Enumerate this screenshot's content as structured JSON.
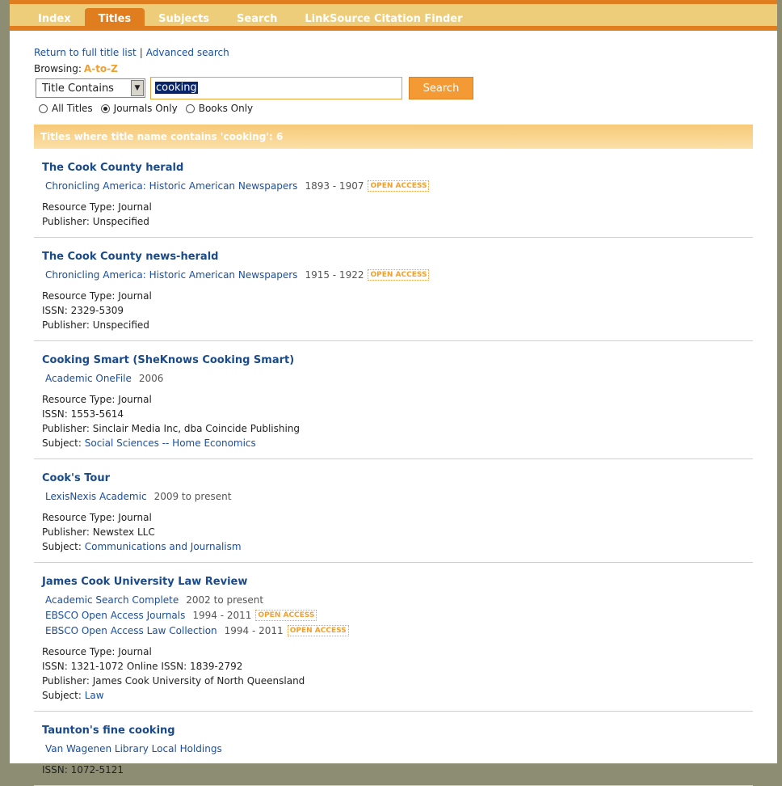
{
  "tabs": [
    "Index",
    "Titles",
    "Subjects",
    "Search",
    "LinkSource Citation Finder"
  ],
  "active_tab": 1,
  "links": {
    "return": "Return to full title list",
    "sep": "|",
    "advanced": "Advanced search"
  },
  "browsing": {
    "label": "Browsing:",
    "value": "A-to-Z"
  },
  "search": {
    "select_value": "Title Contains",
    "input_value": "cooking",
    "button": "Search",
    "radios": [
      {
        "label": "All Titles",
        "checked": false
      },
      {
        "label": "Journals Only",
        "checked": true
      },
      {
        "label": "Books Only",
        "checked": false
      }
    ]
  },
  "results_header": "Titles where title name contains 'cooking': 6",
  "results": [
    {
      "title": "The Cook County herald",
      "sources": [
        {
          "name": "Chronicling America: Historic American Newspapers",
          "dates": "1893 - 1907",
          "oa": "OPEN ACCESS"
        }
      ],
      "meta": [
        {
          "label": "Resource Type:",
          "value": "Journal"
        },
        {
          "label": "Publisher:",
          "value": "Unspecified"
        }
      ]
    },
    {
      "title": "The Cook County news-herald",
      "sources": [
        {
          "name": "Chronicling America: Historic American Newspapers",
          "dates": "1915 - 1922",
          "oa": "OPEN ACCESS"
        }
      ],
      "meta": [
        {
          "label": "Resource Type:",
          "value": "Journal"
        },
        {
          "label": "ISSN:",
          "value": "2329-5309"
        },
        {
          "label": "Publisher:",
          "value": "Unspecified"
        }
      ]
    },
    {
      "title": "Cooking Smart (SheKnows Cooking Smart)",
      "sources": [
        {
          "name": "Academic OneFile",
          "dates": "2006",
          "oa": ""
        }
      ],
      "meta": [
        {
          "label": "Resource Type:",
          "value": "Journal"
        },
        {
          "label": "ISSN:",
          "value": "1553-5614"
        },
        {
          "label": "Publisher:",
          "value": "Sinclair Media Inc, dba Coincide Publishing"
        },
        {
          "label": "Subject:",
          "value": "Social Sciences -- Home Economics",
          "link": true
        }
      ]
    },
    {
      "title": "Cook's Tour",
      "sources": [
        {
          "name": "LexisNexis Academic",
          "dates": "2009 to present",
          "oa": ""
        }
      ],
      "meta": [
        {
          "label": "Resource Type:",
          "value": "Journal"
        },
        {
          "label": "Publisher:",
          "value": "Newstex LLC"
        },
        {
          "label": "Subject:",
          "value": "Communications and Journalism",
          "link": true
        }
      ]
    },
    {
      "title": "James Cook University Law Review",
      "sources": [
        {
          "name": "Academic Search Complete",
          "dates": "2002 to present",
          "oa": ""
        },
        {
          "name": "EBSCO Open Access Journals",
          "dates": "1994 - 2011",
          "oa": "OPEN ACCESS"
        },
        {
          "name": "EBSCO Open Access Law Collection",
          "dates": "1994 - 2011",
          "oa": "OPEN ACCESS"
        }
      ],
      "meta": [
        {
          "label": "Resource Type:",
          "value": "Journal"
        },
        {
          "label": "ISSN:",
          "value": "1321-1072 Online ISSN: 1839-2792"
        },
        {
          "label": "Publisher:",
          "value": "James Cook University of North Queensland"
        },
        {
          "label": "Subject:",
          "value": "Law",
          "link": true
        }
      ]
    },
    {
      "title": "Taunton's fine cooking",
      "sources": [
        {
          "name": "Van Wagenen Library Local Holdings",
          "dates": "",
          "oa": ""
        }
      ],
      "meta": [
        {
          "label": "ISSN:",
          "value": "1072-5121"
        }
      ]
    }
  ]
}
